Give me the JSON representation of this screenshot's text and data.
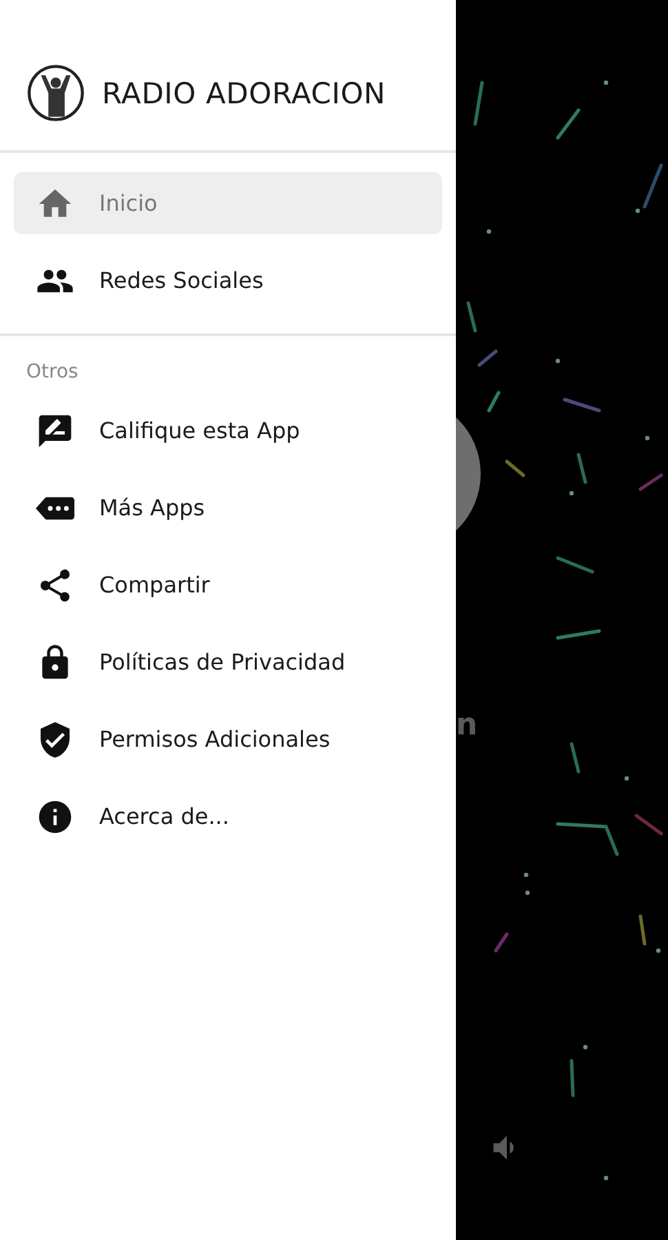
{
  "drawer": {
    "title": "RADIO ADORACION",
    "main_items": [
      {
        "label": "Inicio",
        "selected": true
      },
      {
        "label": "Redes Sociales",
        "selected": false
      }
    ],
    "section_title": "Otros",
    "other_items": [
      {
        "label": "Califique esta App"
      },
      {
        "label": "Más Apps"
      },
      {
        "label": "Compartir"
      },
      {
        "label": "Políticas de Privacidad"
      },
      {
        "label": "Permisos Adicionales"
      },
      {
        "label": "Acerca de..."
      }
    ]
  },
  "background": {
    "station_text_tail": "n"
  }
}
